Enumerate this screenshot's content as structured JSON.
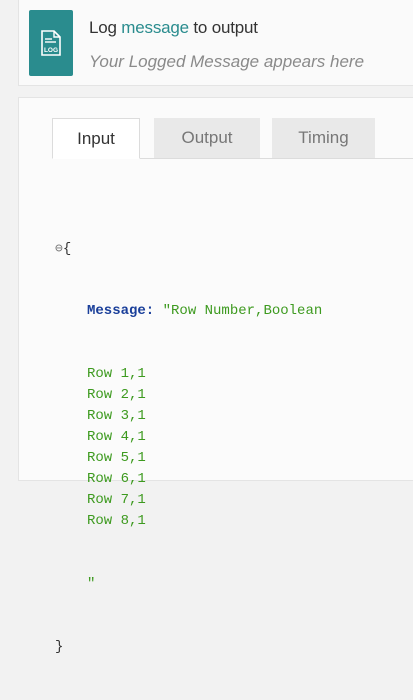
{
  "header": {
    "title_prefix": "Log ",
    "title_link": "message",
    "title_suffix": " to output",
    "subtitle": "Your Logged Message appears here",
    "logo_icon": "log-file-icon",
    "logo_text": "LOG"
  },
  "tabs": [
    {
      "label": "Input",
      "active": true
    },
    {
      "label": "Output",
      "active": false
    },
    {
      "label": "Timing",
      "active": false
    }
  ],
  "code": {
    "collapse_symbol": "⊖",
    "open_brace": "{",
    "key": "Message:",
    "first_value": "\"Row Number,Boolean",
    "rows": [
      "Row 1,1",
      "Row 2,1",
      "Row 3,1",
      "Row 4,1",
      "Row 5,1",
      "Row 6,1",
      "Row 7,1",
      "Row 8,1"
    ],
    "closing_quote": "\"",
    "close_brace": "}"
  },
  "colors": {
    "accent": "#2a8c8e",
    "json_key": "#1a3f9a",
    "json_string": "#3d9a1f"
  }
}
